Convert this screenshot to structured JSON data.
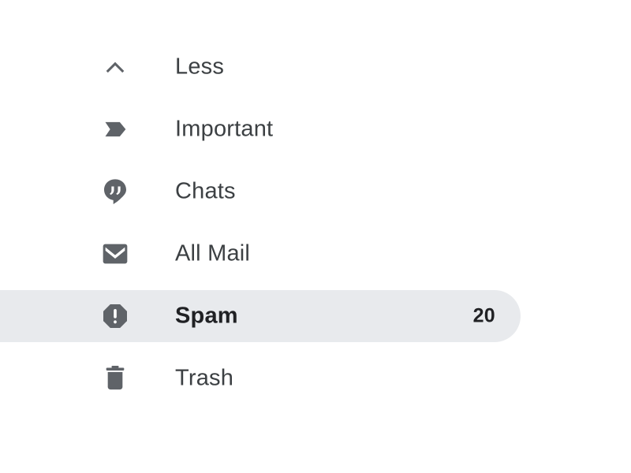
{
  "nav": {
    "items": [
      {
        "label": "Less",
        "icon": "chevron-up-icon",
        "icon_name": "chevron-up-icon",
        "count": "",
        "selected": false
      },
      {
        "label": "Important",
        "icon": "important-label-icon",
        "icon_name": "important-label-icon",
        "count": "",
        "selected": false
      },
      {
        "label": "Chats",
        "icon": "chats-bubble-icon",
        "icon_name": "chats-bubble-icon",
        "count": "",
        "selected": false
      },
      {
        "label": "All Mail",
        "icon": "envelope-icon",
        "icon_name": "envelope-icon",
        "count": "",
        "selected": false
      },
      {
        "label": "Spam",
        "icon": "spam-octagon-icon",
        "icon_name": "spam-octagon-icon",
        "count": "20",
        "selected": true
      },
      {
        "label": "Trash",
        "icon": "trash-icon",
        "icon_name": "trash-icon",
        "count": "",
        "selected": false
      }
    ]
  },
  "colors": {
    "background": "#ffffff",
    "icon_gray": "#5f6368",
    "label_text": "#3c4043",
    "selected_text": "#202124",
    "selected_pill": "#e8eaed"
  }
}
